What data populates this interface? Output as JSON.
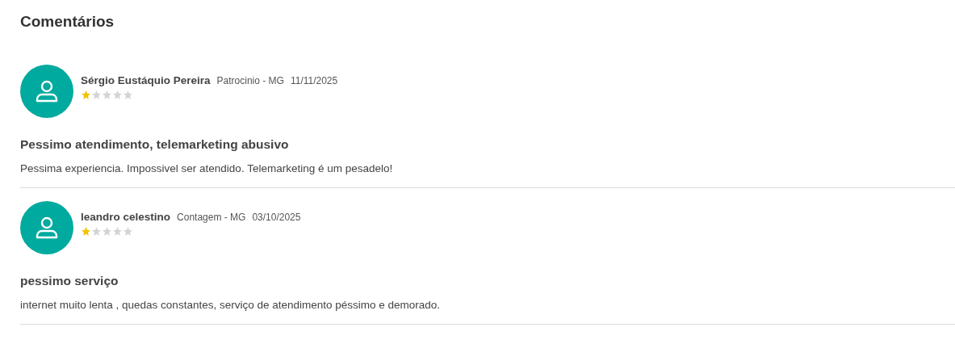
{
  "title": "Comentários",
  "comments": [
    {
      "author": "Sérgio Eustáquio Pereira",
      "location": "Patrocinio - MG",
      "date": "11/11/2025",
      "stars": 1,
      "headline": "Pessimo atendimento, telemarketing abusivo",
      "body": "Pessima experiencia. Impossivel ser atendido. Telemarketing é um pesadelo!"
    },
    {
      "author": "leandro celestino",
      "location": "Contagem - MG",
      "date": "03/10/2025",
      "stars": 1,
      "headline": "pessimo serviço",
      "body": "internet muito lenta , quedas constantes, serviço de atendimento péssimo e demorado."
    }
  ]
}
